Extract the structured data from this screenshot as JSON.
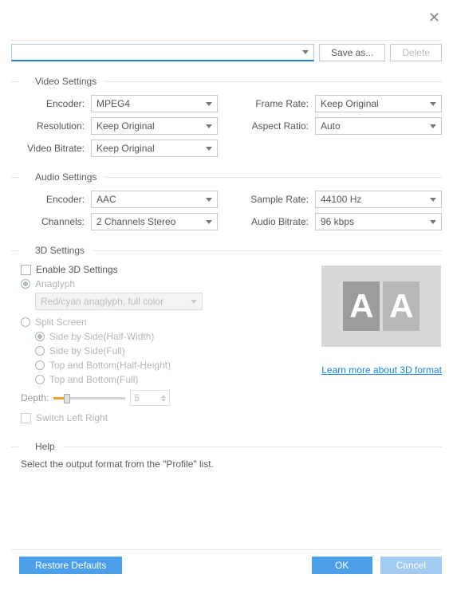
{
  "buttons": {
    "save_as": "Save as...",
    "delete": "Delete",
    "restore_defaults": "Restore Defaults",
    "ok": "OK",
    "cancel": "Cancel"
  },
  "sections": {
    "video": "Video Settings",
    "audio": "Audio Settings",
    "three_d": "3D Settings",
    "help": "Help"
  },
  "video": {
    "encoder_label": "Encoder:",
    "encoder_value": "MPEG4",
    "framerate_label": "Frame Rate:",
    "framerate_value": "Keep Original",
    "resolution_label": "Resolution:",
    "resolution_value": "Keep Original",
    "aspect_label": "Aspect Ratio:",
    "aspect_value": "Auto",
    "bitrate_label": "Video Bitrate:",
    "bitrate_value": "Keep Original"
  },
  "audio": {
    "encoder_label": "Encoder:",
    "encoder_value": "AAC",
    "samplerate_label": "Sample Rate:",
    "samplerate_value": "44100 Hz",
    "channels_label": "Channels:",
    "channels_value": "2 Channels Stereo",
    "bitrate_label": "Audio Bitrate:",
    "bitrate_value": "96 kbps"
  },
  "three_d": {
    "enable": "Enable 3D Settings",
    "anaglyph": "Anaglyph",
    "anaglyph_option": "Red/cyan anaglyph, full color",
    "split": "Split Screen",
    "sideHalf": "Side by Side(Half-Width)",
    "sideFull": "Side by Side(Full)",
    "tbHalf": "Top and Bottom(Half-Height)",
    "tbFull": "Top and Bottom(Full)",
    "depth_label": "Depth:",
    "depth_value": "5",
    "switch": "Switch Left Right",
    "learn": "Learn more about 3D format"
  },
  "help": {
    "text": "Select the output format from the \"Profile\" list."
  }
}
